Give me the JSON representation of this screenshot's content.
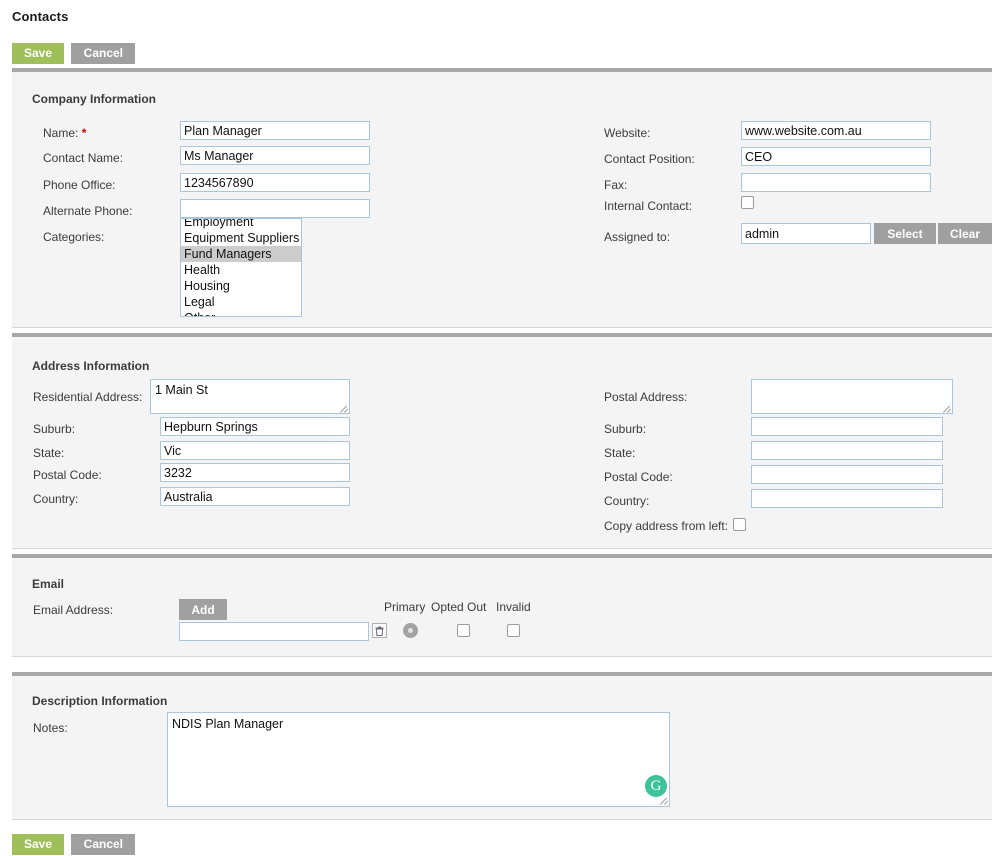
{
  "page": {
    "title": "Contacts"
  },
  "toolbar": {
    "save_label": "Save",
    "cancel_label": "Cancel"
  },
  "footer": {
    "save_label": "Save",
    "cancel_label": "Cancel"
  },
  "colors": {
    "save_green": "#9fbf5a",
    "cancel_gray": "#a0a0a0",
    "section_bar": "#a8a8a8",
    "section_bg": "#f4f4f4",
    "field_border": "#a8c6de",
    "required_red": "#cc0000",
    "selected_option": "#cccccc",
    "grammarly_green": "#3ec29a"
  },
  "company": {
    "title": "Company Information",
    "name": {
      "label": "Name:",
      "required_marker": "*",
      "value": "Plan Manager",
      "placeholder": ""
    },
    "contact_name": {
      "label": "Contact Name:",
      "value": "Ms Manager",
      "placeholder": ""
    },
    "phone_office": {
      "label": "Phone Office:",
      "value": "1234567890",
      "placeholder": ""
    },
    "alternate_phone": {
      "label": "Alternate Phone:",
      "value": "",
      "placeholder": ""
    },
    "categories": {
      "label": "Categories:",
      "options": [
        "Employment",
        "Equipment Suppliers",
        "Fund Managers",
        "Health",
        "Housing",
        "Legal",
        "Other"
      ],
      "selected": "Fund Managers"
    },
    "website": {
      "label": "Website:",
      "value": "www.website.com.au",
      "placeholder": ""
    },
    "contact_position": {
      "label": "Contact Position:",
      "value": "CEO",
      "placeholder": ""
    },
    "fax": {
      "label": "Fax:",
      "value": "",
      "placeholder": ""
    },
    "internal_contact": {
      "label": "Internal Contact:",
      "checked": false
    },
    "assigned_to": {
      "label": "Assigned to:",
      "value": "admin",
      "placeholder": "",
      "select_label": "Select",
      "clear_label": "Clear"
    }
  },
  "address": {
    "title": "Address Information",
    "residential": {
      "label": "Residential Address:",
      "value": "1 Main St",
      "placeholder": ""
    },
    "res_suburb": {
      "label": "Suburb:",
      "value": "Hepburn Springs",
      "placeholder": ""
    },
    "res_state": {
      "label": "State:",
      "value": "Vic",
      "placeholder": ""
    },
    "res_postal_code": {
      "label": "Postal Code:",
      "value": "3232",
      "placeholder": ""
    },
    "res_country": {
      "label": "Country:",
      "value": "Australia",
      "placeholder": ""
    },
    "postal": {
      "label": "Postal Address:",
      "value": "",
      "placeholder": ""
    },
    "post_suburb": {
      "label": "Suburb:",
      "value": "",
      "placeholder": ""
    },
    "post_state": {
      "label": "State:",
      "value": "",
      "placeholder": ""
    },
    "post_postal_code": {
      "label": "Postal Code:",
      "value": "",
      "placeholder": ""
    },
    "post_country": {
      "label": "Country:",
      "value": "",
      "placeholder": ""
    },
    "copy_from_left": {
      "label": "Copy address from left:",
      "checked": false
    }
  },
  "email": {
    "title": "Email",
    "field_label": "Email Address:",
    "add_label": "Add",
    "columns": {
      "primary": "Primary",
      "opted_out": "Opted Out",
      "invalid": "Invalid"
    },
    "row": {
      "address": "",
      "placeholder": "",
      "primary_checked": true,
      "opted_out_checked": false,
      "invalid_checked": false
    }
  },
  "description": {
    "title": "Description Information",
    "notes": {
      "label": "Notes:",
      "value": "NDIS Plan Manager",
      "placeholder": ""
    },
    "assistant_badge": "G"
  }
}
